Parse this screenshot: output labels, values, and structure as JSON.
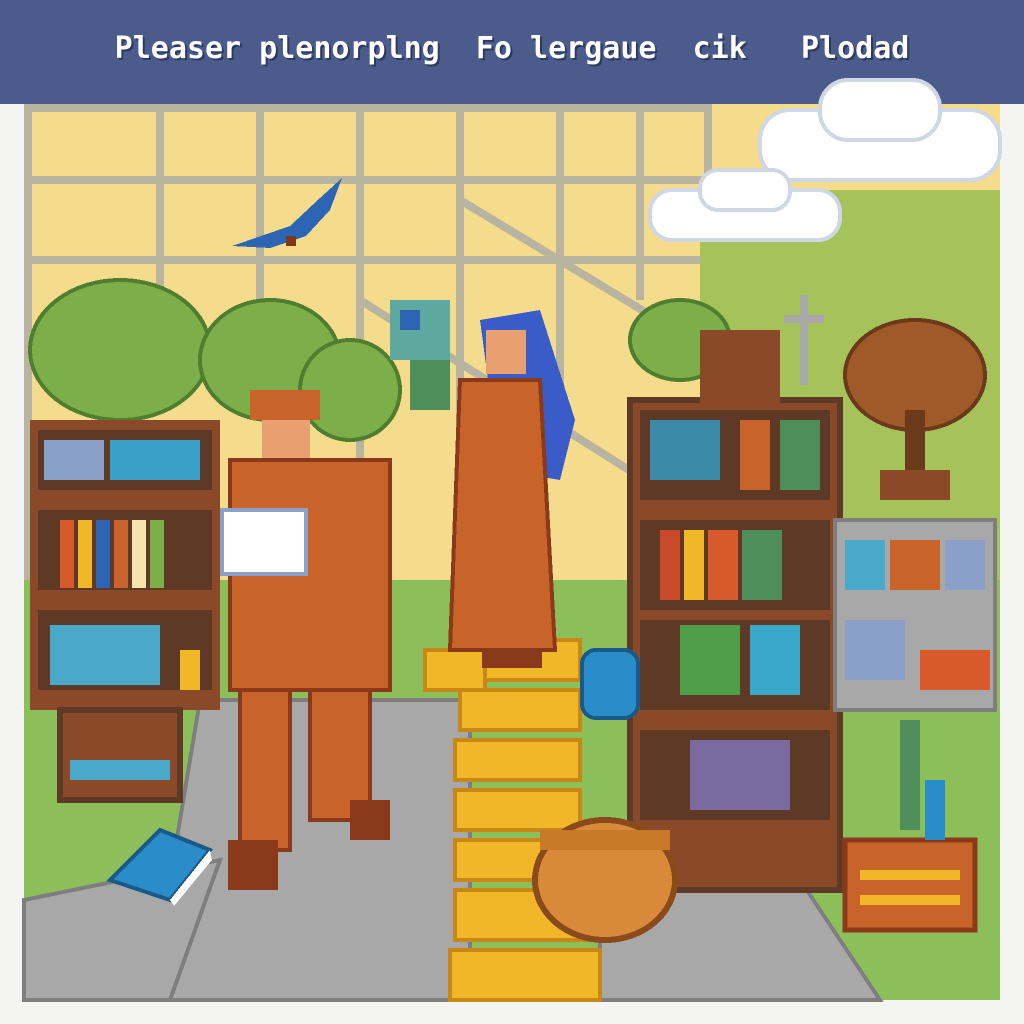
{
  "title": "Pleaser plenorplng  Fo lergaue  cik   Plodad",
  "colors": {
    "title_bar": "#4a5b8c",
    "sky": "#f5dc8c",
    "grass": "#8cbe5a",
    "path_yellow": "#f0b828",
    "robe_brown": "#c8642a",
    "hair_blue": "#3a5cc8",
    "shelf_wood": "#8a4a2a",
    "stone_gray": "#a8a8a8"
  },
  "scene": {
    "elements": [
      {
        "name": "blue-bird-icon",
        "kind": "bird"
      },
      {
        "name": "cloud-icon",
        "kind": "cloud"
      },
      {
        "name": "character-explorer",
        "kind": "character"
      },
      {
        "name": "character-woman-blue-hair",
        "kind": "character"
      },
      {
        "name": "bookshelf-left",
        "kind": "furniture"
      },
      {
        "name": "bookshelf-right",
        "kind": "furniture"
      },
      {
        "name": "potted-tree",
        "kind": "plant"
      },
      {
        "name": "basket",
        "kind": "item"
      },
      {
        "name": "book-on-ground",
        "kind": "item"
      }
    ]
  }
}
